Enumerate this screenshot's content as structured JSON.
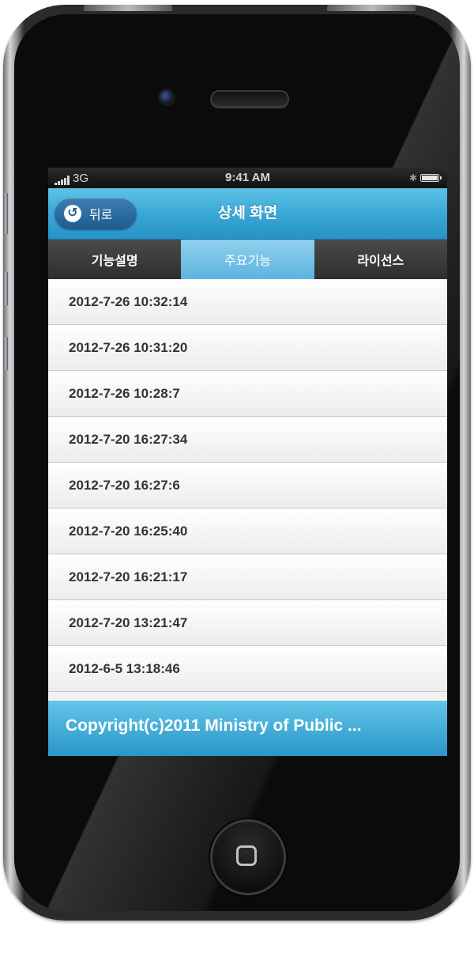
{
  "status_bar": {
    "carrier": "3G",
    "time": "9:41 AM"
  },
  "header": {
    "back_label": "뒤로",
    "title": "상세 화면"
  },
  "tabs": [
    {
      "label": "기능설명",
      "active": false
    },
    {
      "label": "주요기능",
      "active": true
    },
    {
      "label": "라이선스",
      "active": false
    }
  ],
  "list": [
    "2012-7-26 10:32:14",
    "2012-7-26 10:31:20",
    "2012-7-26 10:28:7",
    "2012-7-20 16:27:34",
    "2012-7-20 16:27:6",
    "2012-7-20 16:25:40",
    "2012-7-20 16:21:17",
    "2012-7-20 13:21:47",
    "2012-6-5 13:18:46"
  ],
  "footer": {
    "text": "Copyright(c)2011 Ministry of Public ..."
  },
  "colors": {
    "header_blue": "#3aa8d6",
    "tab_dark": "#3a3a3a",
    "tab_active": "#6fbfe5",
    "footer_blue": "#2a95c9"
  }
}
